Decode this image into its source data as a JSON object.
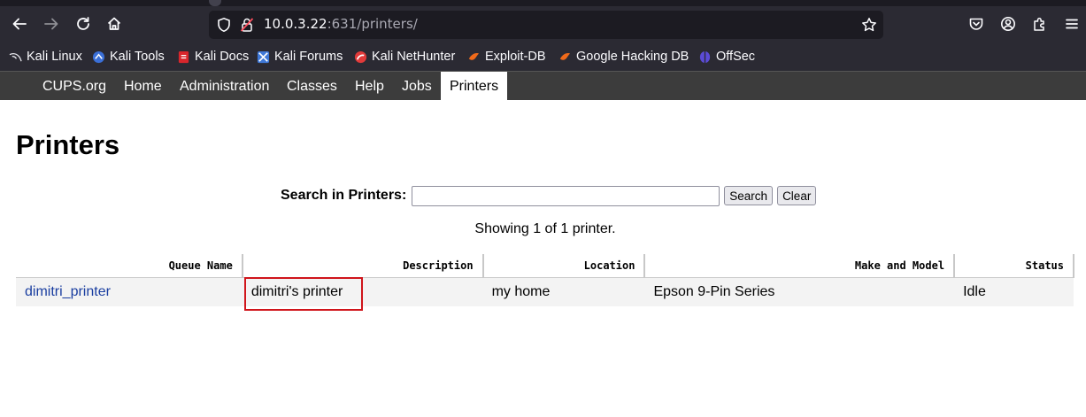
{
  "browser": {
    "url_host": "10.0.3.22",
    "url_path": ":631/printers/",
    "bookmarks": [
      {
        "label": "Kali Linux",
        "icon": "kali-dragon-icon"
      },
      {
        "label": "Kali Tools",
        "icon": "kali-tools-icon"
      },
      {
        "label": "Kali Docs",
        "icon": "kali-docs-icon"
      },
      {
        "label": "Kali Forums",
        "icon": "kali-forums-icon"
      },
      {
        "label": "Kali NetHunter",
        "icon": "nethunter-icon"
      },
      {
        "label": "Exploit-DB",
        "icon": "exploitdb-icon"
      },
      {
        "label": "Google Hacking DB",
        "icon": "ghdb-icon"
      },
      {
        "label": "OffSec",
        "icon": "offsec-icon"
      }
    ]
  },
  "cups_nav": {
    "items": [
      "CUPS.org",
      "Home",
      "Administration",
      "Classes",
      "Help",
      "Jobs",
      "Printers"
    ],
    "active": "Printers"
  },
  "page": {
    "title": "Printers",
    "search_label": "Search in Printers:",
    "search_value": "",
    "search_button": "Search",
    "clear_button": "Clear",
    "showing_text": "Showing 1 of 1 printer."
  },
  "table": {
    "headers": [
      "Queue Name",
      "Description",
      "Location",
      "Make and Model",
      "Status"
    ],
    "rows": [
      {
        "queue": "dimitri_printer",
        "description": "dimitri's printer",
        "location": "my home",
        "model": "Epson 9-Pin Series",
        "status": "Idle"
      }
    ]
  },
  "colors": {
    "toolbar_bg": "#2b2a33",
    "cups_nav_bg": "#3c3c3c",
    "link": "#1a3ea0",
    "highlight_box": "#d0151b"
  }
}
